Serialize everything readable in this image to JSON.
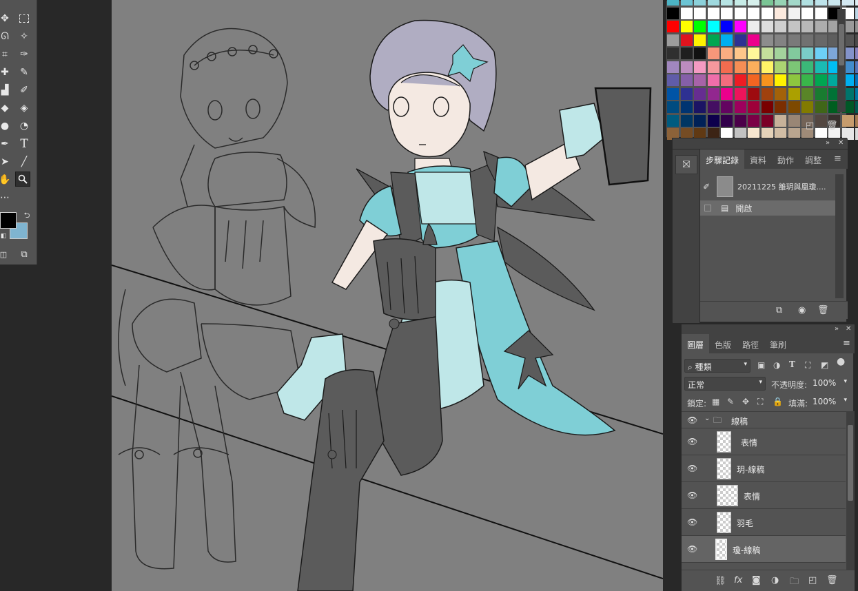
{
  "toolbar": {
    "tools": [
      "move-tool",
      "marquee-tool",
      "lasso-tool",
      "magic-wand-tool",
      "crop-tool",
      "eyedropper-tool",
      "healing-brush-tool",
      "brush-tool",
      "clone-stamp-tool",
      "history-brush-tool",
      "eraser-tool",
      "paint-bucket-tool",
      "blur-tool",
      "dodge-tool",
      "pen-tool",
      "type-tool",
      "path-selection-tool",
      "line-tool",
      "hand-tool",
      "zoom-tool",
      "more-tools"
    ],
    "type_tool_label": "T",
    "foreground_color": "#000000",
    "background_color": "#7fb4d0"
  },
  "swatches": {
    "rows": [
      [
        "#4cb3c4",
        "#6cc4d4",
        "#8bd0da",
        "#9fd9df",
        "#b7e4e4",
        "#c6ebe6",
        "#d6f0ec",
        "#7ac595",
        "#96d3b4",
        "#a2d8c9",
        "#b0dfe0",
        "#bde3ea",
        "#c9e6ee",
        "#d3e8f1",
        "#dfeff5"
      ],
      [
        "#000000",
        "#ffffff",
        "#ffffff",
        "#ffffff",
        "#ffffff",
        "#ffffff",
        "#ffffff",
        "#ffffff",
        "#fbe9dd",
        "#f2f2f2",
        "#ffffff",
        "#ffffff",
        "#000000",
        "#ffffff",
        "#bcd6e6"
      ],
      [
        "#ff0000",
        "#ffff00",
        "#00ff00",
        "#00ffff",
        "#0000ff",
        "#ff00ff",
        "#ececec",
        "#dddddd",
        "#cfcfcf",
        "#c4c4c4",
        "#b8b8b8",
        "#adadad",
        "#a3a3a3",
        "#9a9a9a",
        "#909090"
      ],
      [
        "#9c9c9c",
        "#e0141e",
        "#fff200",
        "#00a651",
        "#00aeef",
        "#2e3192",
        "#ec008c",
        "#8d8d8d",
        "#838383",
        "#7a7a7a",
        "#717171",
        "#686868",
        "#5e5e5e",
        "#555555",
        "#4b4b4b"
      ],
      [
        "#2f2f2f",
        "#1f1f1f",
        "#111111",
        "#f7977a",
        "#f9ad81",
        "#fdc68a",
        "#fff79a",
        "#c4df9b",
        "#a3d39c",
        "#82ca9d",
        "#7accc8",
        "#6dcff6",
        "#7da7d9",
        "#8393ca",
        "#8781bd"
      ],
      [
        "#a187be",
        "#bc8cbf",
        "#f49ac2",
        "#f6989d",
        "#f26c4f",
        "#f68e55",
        "#fbaf5c",
        "#fff467",
        "#acd372",
        "#7cc576",
        "#3bb878",
        "#1abbb4",
        "#00bff3",
        "#438ccb",
        "#5574b9"
      ],
      [
        "#605ca8",
        "#855fa8",
        "#a763a8",
        "#f06eaa",
        "#f26d7d",
        "#ed1c24",
        "#f26522",
        "#f7941d",
        "#fff200",
        "#8dc63f",
        "#39b54a",
        "#00a651",
        "#00a99d",
        "#00aeef",
        "#0072bc"
      ],
      [
        "#0054a6",
        "#2e3192",
        "#662d91",
        "#92278f",
        "#ec008c",
        "#ed145b",
        "#9e0b0f",
        "#a0410d",
        "#a36209",
        "#aba000",
        "#598527",
        "#197b30",
        "#007236",
        "#00746b",
        "#0076a3"
      ],
      [
        "#004b80",
        "#003471",
        "#1b1464",
        "#440e62",
        "#630460",
        "#9e005d",
        "#9e0039",
        "#790000",
        "#7b2e00",
        "#7d4900",
        "#827b00",
        "#406618",
        "#005e20",
        "#005826",
        "#005952"
      ],
      [
        "#005b7f",
        "#003663",
        "#002157",
        "#0d004c",
        "#32004b",
        "#4b0049",
        "#7b0046",
        "#7a0026",
        "#c7b299",
        "#998675",
        "#736357",
        "#534741",
        "#37302d",
        "#c69c6d",
        "#a67c52"
      ],
      [
        "#8c6239",
        "#754c24",
        "#603913",
        "#3c2415",
        "#ffffff",
        "#c2c2c2",
        "#f7e6cf",
        "#e5d2b8",
        "#d1bda4",
        "#b9a58f",
        "#9f8b78",
        "#ffffff",
        "#f2f2f2",
        "#e6e6e6",
        "#d9d9d9"
      ]
    ]
  },
  "history_panel": {
    "tabs": [
      "步驟記錄",
      "資料",
      "動作",
      "調整"
    ],
    "snapshot_label": "20211225 雒玥與凰瓊....",
    "items": [
      "開啟"
    ]
  },
  "layers_panel": {
    "tabs": [
      "圖層",
      "色版",
      "路徑",
      "筆刷"
    ],
    "filter_kind": "種類",
    "blend_mode": "正常",
    "opacity_label": "不透明度:",
    "opacity_value": "100%",
    "lock_label": "鎖定:",
    "fill_label": "填滿:",
    "fill_value": "100%",
    "group_name": "線稿",
    "layers": [
      "表情",
      "玥-線稿",
      "表情",
      "羽毛",
      "瓊-線稿"
    ]
  }
}
